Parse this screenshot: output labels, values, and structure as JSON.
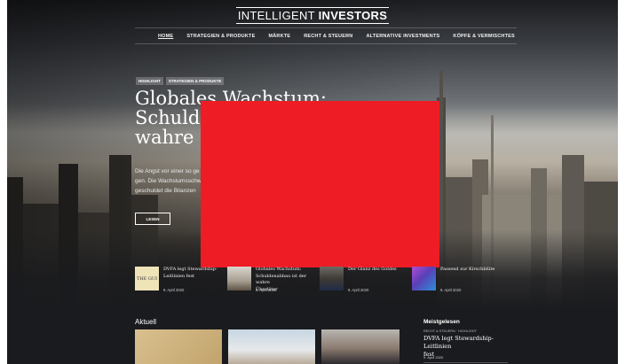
{
  "site": {
    "logo_light": "INTELLIGENT ",
    "logo_bold": "INVESTORS"
  },
  "nav": {
    "items": [
      {
        "label": "HOME",
        "active": true
      },
      {
        "label": "STRATEGIEN & PRODUKTE"
      },
      {
        "label": "MÄRKTE"
      },
      {
        "label": "RECHT & STEUERN"
      },
      {
        "label": "ALTERNATIVE INVESTMENTS"
      },
      {
        "label": "KÖPFE & VERMISCHTES"
      }
    ]
  },
  "hero": {
    "tags": [
      "HIGHLIGHT",
      "STRATEGIEN & PRODUKTE"
    ],
    "headline_lines": [
      "Globales Wachstum:",
      "Schulde",
      "wahre Ü"
    ],
    "excerpt_lines": [
      "Die Angst vor einer so ge",
      "gen. Die Wachstumsschw",
      "geschuldet die Bilanzen"
    ],
    "button_label": "LESEN"
  },
  "cards": [
    {
      "title_lines": [
        "DVFA legt Stewardship-",
        "Leitlinien fest"
      ],
      "date": "9. April 2020",
      "thumb_text": "THE GUI"
    },
    {
      "title_lines": [
        "Globales Wachstum:",
        "Schuldenabbau ist der wahre",
        "Überläter"
      ],
      "date": "9. April 2020"
    },
    {
      "title_lines": [
        "Der Glanz des Goldes"
      ],
      "date": "9. April 2020"
    },
    {
      "title_lines": [
        "Passend zur Kirschblüte"
      ],
      "date": "9. April 2020"
    }
  ],
  "sections": {
    "aktuell_title": "Aktuell",
    "meistgelesen": {
      "title": "Meistgelesen",
      "tags": "RECHT & STEUERN · HIGHLIGHT",
      "headline_lines": [
        "DVFA legt Stewardship-Leitlinien",
        "fest"
      ],
      "date": "9. April 2020"
    }
  },
  "colors": {
    "overlay_red": "#ee1c25",
    "background_dark": "#1a1b1e",
    "text_white": "#ffffff"
  }
}
